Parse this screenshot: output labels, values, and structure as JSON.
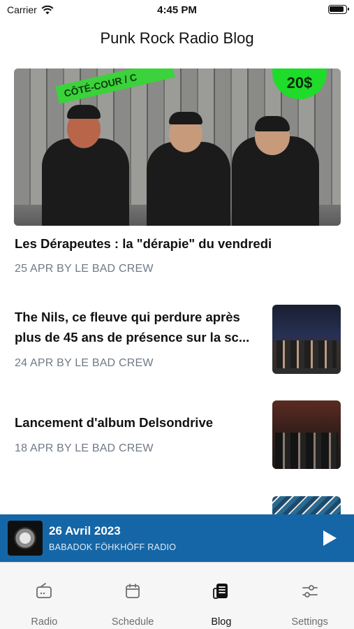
{
  "status_bar": {
    "carrier": "Carrier",
    "time": "4:45 PM"
  },
  "header": {
    "title": "Punk Rock Radio Blog"
  },
  "posts": [
    {
      "title": "Les Dérapeutes : la \"dérapie\" du vendredi",
      "meta": "25 APR BY LE BAD CREW",
      "image_sticker": "CÔTÉ-COUR / C",
      "image_price": "20$"
    },
    {
      "title_line1": "The Nils, ce fleuve qui perdure après",
      "title_line2": "plus de 45 ans de présence sur la sc...",
      "meta": "24 APR BY LE BAD CREW"
    },
    {
      "title": "Lancement d'album Delsondrive",
      "meta": "18 APR BY LE BAD CREW"
    }
  ],
  "now_playing": {
    "title": "26 Avril 2023",
    "subtitle": "BABADOK FÖHKHÖFF RADIO",
    "play_icon": "play-icon"
  },
  "tabs": [
    {
      "label": "Radio",
      "icon": "radio-icon",
      "active": false
    },
    {
      "label": "Schedule",
      "icon": "calendar-icon",
      "active": false
    },
    {
      "label": "Blog",
      "icon": "blog-icon",
      "active": true
    },
    {
      "label": "Settings",
      "icon": "sliders-icon",
      "active": false
    }
  ],
  "colors": {
    "accent": "#1566a6",
    "meta_text": "#707a85",
    "tab_inactive": "#6d6d72",
    "tab_active": "#111111"
  }
}
